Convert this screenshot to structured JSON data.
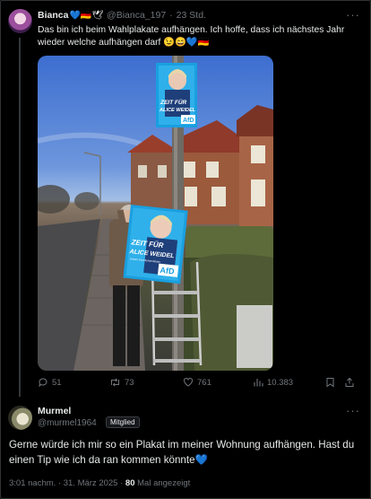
{
  "tweet1": {
    "author_name": "Bianca",
    "author_emojis": "💙🇩🇪🕊",
    "handle": "@Bianca_197",
    "separator": "·",
    "time": "23 Std.",
    "more_label": "···",
    "text": "Das bin ich beim Wahlplakate aufhängen. Ich hoffe, dass ich nächstes Jahr wieder welche aufhängen darf 😉😄💙🇩🇪",
    "poster": {
      "headline_line1": "ZEIT FÜR",
      "headline_line2": "ALICE WEIDEL",
      "subline": "Unsere Kanzlerkandidatin",
      "logo": "AfD"
    },
    "stats": {
      "replies": "51",
      "reposts": "73",
      "likes": "761",
      "views": "10.383"
    },
    "icons": [
      "reply-icon",
      "repost-icon",
      "like-icon",
      "views-icon",
      "bookmark-icon",
      "share-icon"
    ]
  },
  "tweet2": {
    "author_name": "Murmel",
    "handle": "@murmel1964",
    "badge": "Mitglied",
    "more_label": "···",
    "text": "Gerne würde ich mir so ein Plakat im meiner Wohnung aufhängen. Hast du einen Tip wie ich da ran kommen könnte💙",
    "timestamp": "3:01 nachm. · 31. März 2025 ·",
    "views_count": "80",
    "views_label": "Mal angezeigt"
  },
  "colors": {
    "background": "#000000",
    "text": "#e7e9ea",
    "muted": "#71767b",
    "border": "#2f3336",
    "afd_blue": "#1a9fe0"
  }
}
